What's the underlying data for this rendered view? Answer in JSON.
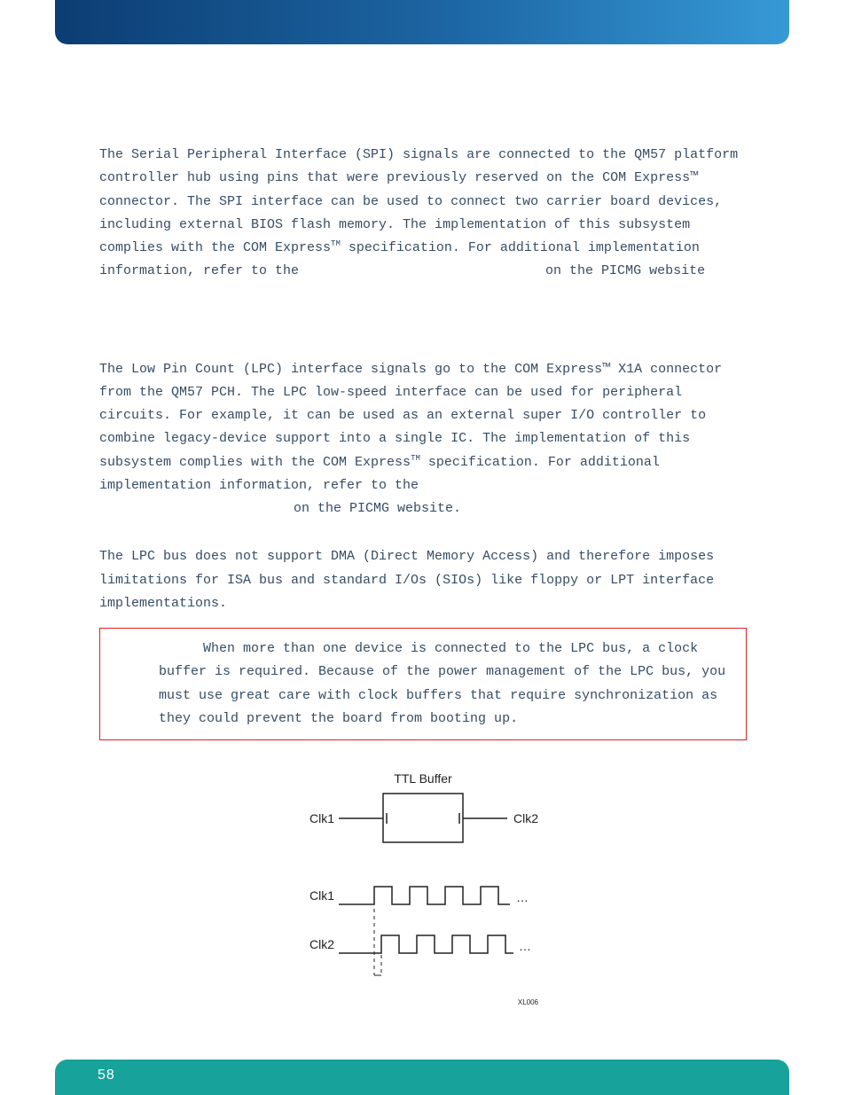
{
  "section_spi": {
    "para1_a": "The Serial Peripheral Interface (SPI) signals are connected to the QM57 platform controller hub using pins that were previously reserved on the COM Express™ connector. The SPI interface can be used to connect two carrier board devices, including external BIOS flash memory. The implementation of this subsystem complies with the COM Express",
    "tm1": "TM",
    "para1_b": " specification. For additional implementation information, refer to the ",
    "para1_c": " on the PICMG website"
  },
  "section_lpc": {
    "para1_a": "The Low Pin Count (LPC) interface signals go to the COM Express™ X1A connector from the QM57 PCH.  The LPC low-speed interface can be used for peripheral circuits.  For example, it can be used as an external super I/O controller to combine legacy-device support into a single IC. The implementation of this subsystem complies with the COM Express",
    "tm1": "TM",
    "para1_b": " specification. For additional implementation information, refer to the ",
    "para1_c": " on the PICMG website.",
    "para2": "The LPC bus does not support DMA (Direct Memory Access) and therefore imposes limitations for ISA bus and standard I/Os (SIOs) like floppy or LPT interface implementations."
  },
  "note": {
    "text": "When more than one device is connected to the LPC bus, a clock buffer is required. Because of the power management of the LPC bus, you must use great care with clock buffers that require synchronization as they could prevent the board from booting up."
  },
  "figure": {
    "ttl_buffer": "TTL Buffer",
    "clk1": "Clk1",
    "clk2": "Clk2",
    "dots": "…",
    "code": "XL006"
  },
  "page": "58"
}
